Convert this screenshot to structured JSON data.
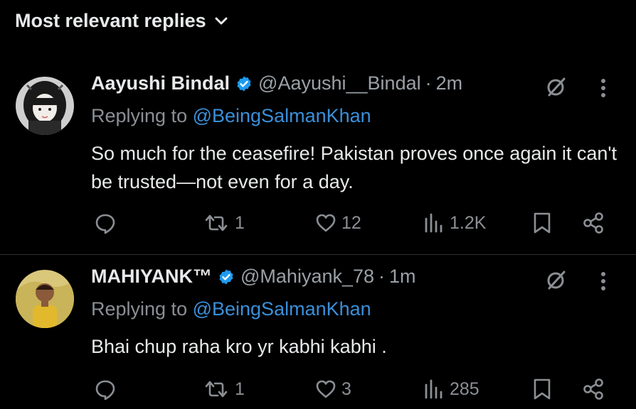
{
  "header": {
    "sort_label": "Most relevant replies"
  },
  "replies": [
    {
      "name": "Aayushi Bindal",
      "handle": "@Aayushi__Bindal",
      "separator": "·",
      "time": "2m",
      "replying_prefix": "Replying to ",
      "replying_to": "@BeingSalmanKhan",
      "text": "So much for the ceasefire! Pakistan proves once again it can't be trusted—not even for a day.",
      "reply_count": "",
      "repost_count": "1",
      "like_count": "12",
      "view_count": "1.2K"
    },
    {
      "name": "MAHIYANK™",
      "handle": "@Mahiyank_78",
      "separator": "·",
      "time": "1m",
      "replying_prefix": "Replying to ",
      "replying_to": "@BeingSalmanKhan",
      "text": "Bhai chup raha kro yr kabhi kabhi .",
      "reply_count": "",
      "repost_count": "1",
      "like_count": "3",
      "view_count": "285"
    }
  ],
  "colors": {
    "accent": "#1d9bf0",
    "mention": "#3b8fd9",
    "muted": "#8b8f94",
    "text": "#e7e9ea",
    "background": "#000000"
  },
  "icons": [
    "chevron-down-icon",
    "verified-badge-icon",
    "grok-icon",
    "more-icon",
    "reply-icon",
    "repost-icon",
    "like-icon",
    "views-icon",
    "bookmark-icon",
    "share-icon"
  ]
}
